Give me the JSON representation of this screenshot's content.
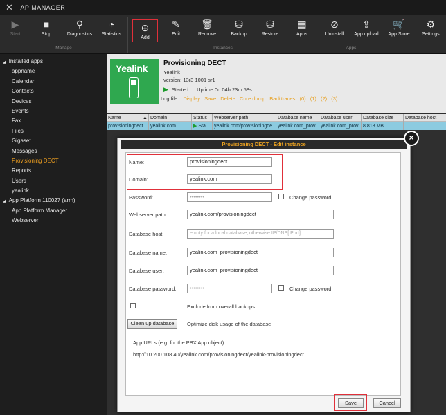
{
  "window": {
    "title": "AP MANAGER"
  },
  "toolbar": {
    "groups": {
      "manage": "Manage",
      "instances": "Instances",
      "apps": "Apps"
    },
    "buttons": {
      "start": "Start",
      "stop": "Stop",
      "diagnostics": "Diagnostics",
      "statistics": "Statistics",
      "add": "Add",
      "edit": "Edit",
      "remove": "Remove",
      "backup": "Backup",
      "restore": "Restore",
      "apps": "Apps",
      "uninstall": "Uninstall",
      "app_upload": "App upload",
      "app_store": "App Store",
      "settings": "Settings"
    }
  },
  "sidebar": {
    "installed": "Installed apps",
    "apps": [
      "appname",
      "Calendar",
      "Contacts",
      "Devices",
      "Events",
      "Fax",
      "Files",
      "Gigaset",
      "Messages",
      "Provisioning DECT",
      "Reports",
      "Users",
      "yealink"
    ],
    "platform": "App Platform 110027 (arm)",
    "platform_items": [
      "App Platform Manager",
      "Webserver"
    ]
  },
  "app_header": {
    "logo": "Yealink",
    "title": "Provisioning DECT",
    "vendor": "Yealink",
    "version": "version: 13r3 1001 sr1",
    "status": "Started",
    "uptime": "Uptime 0d 04h 23m 58s",
    "logfile_label": "Log file:",
    "links": [
      "Display",
      "Save",
      "Delete",
      "Core dump",
      "Backtraces",
      "(0)",
      "(1)",
      "(2)",
      "(3)"
    ]
  },
  "grid": {
    "headers": [
      "Name",
      "Domain",
      "Status",
      "Webserver path",
      "Database name",
      "Database user",
      "Database size",
      "Database host"
    ],
    "row": {
      "name": "provisioningdect",
      "domain": "yealink.com",
      "status": "Sta",
      "webpath": "yealink.com/provisioningde",
      "dbname": "yealink.com_provi",
      "dbuser": "yealink.com_provi",
      "dbsize": "8 818 MB",
      "dbhost": ""
    }
  },
  "dialog": {
    "title": "Provisioning DECT - Edit instance",
    "close": "×",
    "fields": {
      "name": {
        "label": "Name:",
        "value": "provisioningdect"
      },
      "domain": {
        "label": "Domain:",
        "value": "yealink.com"
      },
      "password": {
        "label": "Password:",
        "value": "••••••••"
      },
      "change_password": "Change password",
      "webpath": {
        "label": "Webserver path:",
        "value": "yealink.com/provisioningdect"
      },
      "dbhost": {
        "label": "Database host:",
        "placeholder": "empty for a local database, otherwise IP/DNS[:Port]"
      },
      "dbname": {
        "label": "Database name:",
        "value": "yealink.com_provisioningdect"
      },
      "dbuser": {
        "label": "Database user:",
        "value": "yealink.com_provisioningdect"
      },
      "dbpassword": {
        "label": "Database password:",
        "value": "••••••••"
      },
      "change_password2": "Change password",
      "exclude_backups": "Exclude from overall backups",
      "cleanup_btn": "Clean up database",
      "cleanup_desc": "Optimize disk usage of the database",
      "app_urls_label": "App URLs (e.g. for the PBX App object):",
      "app_url": "http://10.200.108.40/yealink.com/provisioningdect/yealink-provisioningdect"
    },
    "save": "Save",
    "cancel": "Cancel"
  }
}
